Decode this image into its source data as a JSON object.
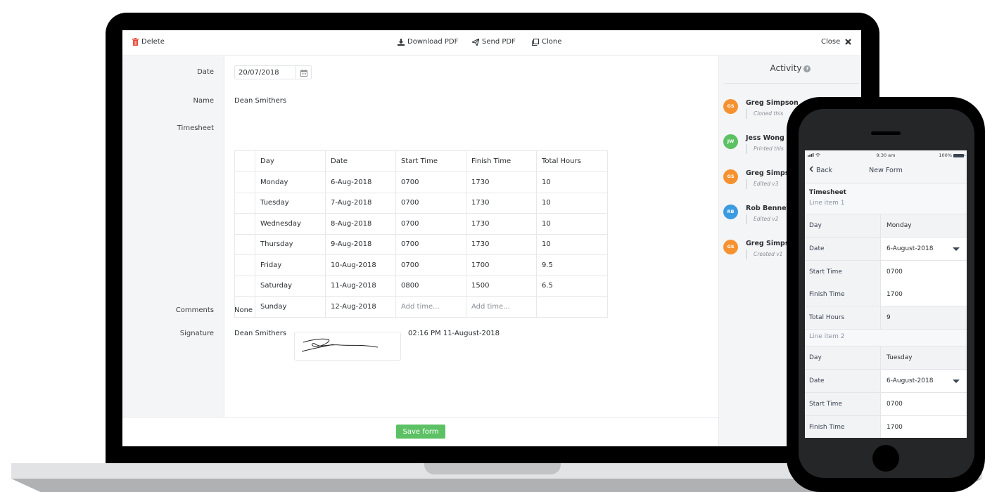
{
  "toolbar": {
    "delete_label": "Delete",
    "download_pdf_label": "Download PDF",
    "send_pdf_label": "Send PDF",
    "clone_label": "Clone",
    "close_label": "Close"
  },
  "form": {
    "labels": {
      "date": "Date",
      "name": "Name",
      "timesheet": "Timesheet",
      "comments": "Comments",
      "signature": "Signature"
    },
    "date_value": "20/07/2018",
    "name_value": "Dean Smithers",
    "comments_value": "None",
    "signature_name": "Dean Smithers",
    "signature_timestamp": "02:16 PM 11-August-2018",
    "timesheet": {
      "columns": [
        "",
        "Day",
        "Date",
        "Start Time",
        "Finish Time",
        "Total Hours"
      ],
      "rows": [
        {
          "day": "Monday",
          "date": "6-Aug-2018",
          "start": "0700",
          "finish": "1730",
          "total": "10"
        },
        {
          "day": "Tuesday",
          "date": "7-Aug-2018",
          "start": "0700",
          "finish": "1730",
          "total": "10"
        },
        {
          "day": "Wednesday",
          "date": "8-Aug-2018",
          "start": "0700",
          "finish": "1730",
          "total": "10"
        },
        {
          "day": "Thursday",
          "date": "9-Aug-2018",
          "start": "0700",
          "finish": "1730",
          "total": "10"
        },
        {
          "day": "Friday",
          "date": "10-Aug-2018",
          "start": "0700",
          "finish": "1700",
          "total": "9.5"
        },
        {
          "day": "Saturday",
          "date": "11-Aug-2018",
          "start": "0800",
          "finish": "1500",
          "total": "6.5"
        },
        {
          "day": "Sunday",
          "date": "12-Aug-2018",
          "start": "",
          "finish": "",
          "total": ""
        }
      ],
      "add_time_placeholder": "Add time..."
    },
    "save_label": "Save form"
  },
  "activity": {
    "title": "Activity",
    "help_glyph": "?",
    "items": [
      {
        "initials": "GS",
        "name": "Greg Simpson",
        "action": "Cloned this",
        "color": "#f5922f"
      },
      {
        "initials": "JW",
        "name": "Jess Wong",
        "action": "Printed this",
        "color": "#5cc164"
      },
      {
        "initials": "GS",
        "name": "Greg Simpson",
        "action": "Edited v3",
        "color": "#f5922f"
      },
      {
        "initials": "RB",
        "name": "Rob Bennett",
        "action": "Edited v2",
        "color": "#3a9be0"
      },
      {
        "initials": "GS",
        "name": "Greg Simpson",
        "action": "Created v1",
        "color": "#f5922f"
      }
    ]
  },
  "phone": {
    "status": {
      "time": "9:30 am",
      "battery": "100%"
    },
    "back_label": "Back",
    "title": "New Form",
    "section_title": "Timesheet",
    "line_items": [
      {
        "label": "Line item 1",
        "fields": [
          {
            "label": "Day",
            "value": "Monday"
          },
          {
            "label": "Date",
            "value": "6-August-2018"
          },
          {
            "label": "Start Time",
            "value": "0700"
          },
          {
            "label": "Finish Time",
            "value": "1700"
          },
          {
            "label": "Total Hours",
            "value": "9"
          }
        ]
      },
      {
        "label": "Line item 2",
        "fields": [
          {
            "label": "Day",
            "value": "Tuesday"
          },
          {
            "label": "Date",
            "value": "6-August-2018"
          },
          {
            "label": "Start Time",
            "value": "0700"
          },
          {
            "label": "Finish Time",
            "value": "1700"
          }
        ]
      }
    ]
  },
  "colors": {
    "accent_green": "#5cc164",
    "delete_red": "#e74c3c"
  }
}
